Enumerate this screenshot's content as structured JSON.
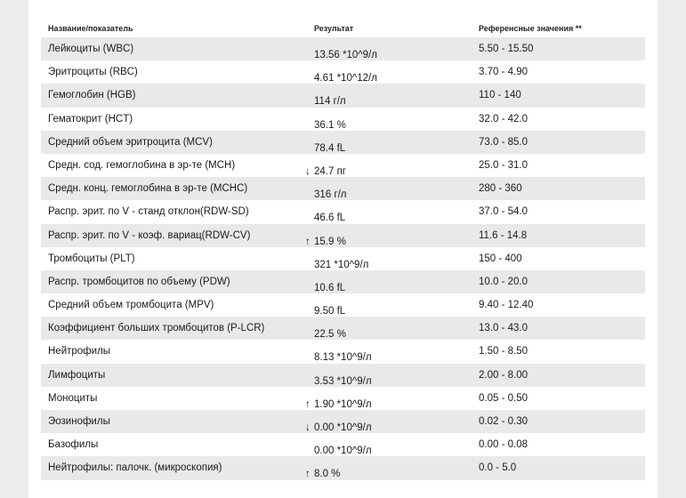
{
  "table": {
    "headers": [
      "Название/показатель",
      "Результат",
      "Референсные значения **"
    ],
    "rows": [
      {
        "name": "Лейкоциты (WBC)",
        "result": "13.56 *10^9/л",
        "flag": "",
        "ref": "5.50 - 15.50"
      },
      {
        "name": "Эритроциты (RBC)",
        "result": "4.61 *10^12/л",
        "flag": "",
        "ref": "3.70 - 4.90"
      },
      {
        "name": "Гемоглобин (HGB)",
        "result": "114 г/л",
        "flag": "",
        "ref": "110 - 140"
      },
      {
        "name": "Гематокрит (HCT)",
        "result": "36.1 %",
        "flag": "",
        "ref": "32.0 - 42.0"
      },
      {
        "name": "Средний объем эритроцита (MCV)",
        "result": "78.4 fL",
        "flag": "",
        "ref": "73.0 - 85.0"
      },
      {
        "name": "Средн. сод. гемоглобина в эр-те (MCH)",
        "result": "24.7 пг",
        "flag": "↓",
        "ref": "25.0 - 31.0"
      },
      {
        "name": "Средн. конц. гемоглобина в эр-те (MCHC)",
        "result": "316 г/л",
        "flag": "",
        "ref": "280 - 360"
      },
      {
        "name": "Распр. эрит. по V - станд отклон(RDW-SD)",
        "result": "46.6 fL",
        "flag": "",
        "ref": "37.0 - 54.0"
      },
      {
        "name": "Распр. эрит. по V - коэф. вариац(RDW-CV)",
        "result": "15.9 %",
        "flag": "↑",
        "ref": "11.6 - 14.8"
      },
      {
        "name": "Тромбоциты (PLT)",
        "result": "321 *10^9/л",
        "flag": "",
        "ref": "150 - 400"
      },
      {
        "name": "Распр. тромбоцитов по объему (PDW)",
        "result": "10.6 fL",
        "flag": "",
        "ref": "10.0 - 20.0"
      },
      {
        "name": "Средний объем тромбоцита (MPV)",
        "result": "9.50 fL",
        "flag": "",
        "ref": "9.40 - 12.40"
      },
      {
        "name": "Коэффициент больших тромбоцитов (P-LCR)",
        "result": "22.5 %",
        "flag": "",
        "ref": "13.0 - 43.0"
      },
      {
        "name": "Нейтрофилы",
        "result": "8.13 *10^9/л",
        "flag": "",
        "ref": "1.50 - 8.50"
      },
      {
        "name": "Лимфоциты",
        "result": "3.53 *10^9/л",
        "flag": "",
        "ref": "2.00 - 8.00"
      },
      {
        "name": "Моноциты",
        "result": "1.90 *10^9/л",
        "flag": "↑",
        "ref": "0.05 - 0.50"
      },
      {
        "name": "Эозинофилы",
        "result": "0.00 *10^9/л",
        "flag": "↓",
        "ref": "0.02 - 0.30"
      },
      {
        "name": "Базофилы",
        "result": "0.00 *10^9/л",
        "flag": "",
        "ref": "0.00 - 0.08"
      },
      {
        "name": "Нейтрофилы: палочк. (микроскопия)",
        "result": "8.0 %",
        "flag": "↑",
        "ref": "0.0 - 5.0"
      }
    ]
  }
}
